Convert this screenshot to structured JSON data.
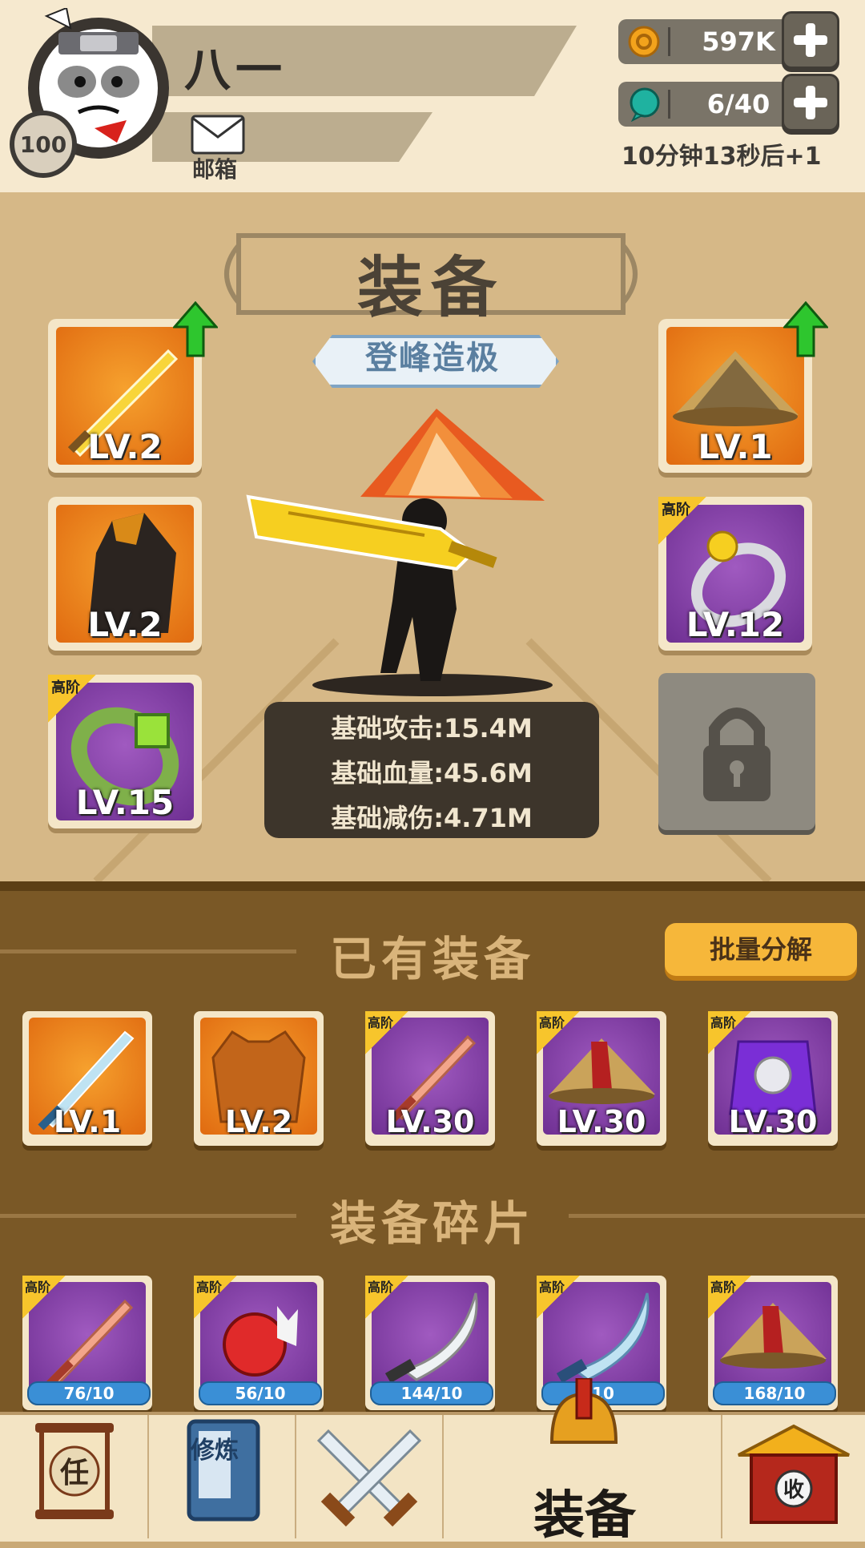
{
  "player": {
    "name": "八一",
    "level": "100",
    "mail_label": "邮箱"
  },
  "resources": {
    "gold": {
      "value": "597K",
      "icon": "coin-icon"
    },
    "stamina": {
      "value": "6/40",
      "icon": "gem-icon",
      "timer": "10分钟13秒后+1"
    }
  },
  "equipment": {
    "title": "装备",
    "rank": "登峰造极",
    "left_slots": [
      {
        "level": "LV.2",
        "icon": "golden-sword-icon",
        "rarity": "",
        "upgrade": true
      },
      {
        "level": "LV.2",
        "icon": "cloak-icon",
        "rarity": "",
        "upgrade": false
      },
      {
        "level": "LV.15",
        "icon": "jade-bracelet-icon",
        "rarity": "高阶",
        "upgrade": false
      }
    ],
    "right_slots": [
      {
        "level": "LV.1",
        "icon": "straw-hat-icon",
        "rarity": "",
        "upgrade": true
      },
      {
        "level": "LV.12",
        "icon": "ring-icon",
        "rarity": "高阶",
        "upgrade": false
      }
    ],
    "stats": [
      "基础攻击:15.4M",
      "基础血量:45.6M",
      "基础减伤:4.71M"
    ]
  },
  "owned": {
    "title": "已有装备",
    "batch_button": "批量分解",
    "items": [
      {
        "level": "LV.1",
        "icon": "blue-sword-icon",
        "rarity": ""
      },
      {
        "level": "LV.2",
        "icon": "vest-icon",
        "rarity": ""
      },
      {
        "level": "LV.30",
        "icon": "wooden-sword-icon",
        "rarity": "高阶"
      },
      {
        "level": "LV.30",
        "icon": "straw-hat-icon",
        "rarity": "高阶"
      },
      {
        "level": "LV.30",
        "icon": "purple-armor-icon",
        "rarity": "高阶"
      }
    ]
  },
  "fragments": {
    "title": "装备碎片",
    "items": [
      {
        "progress": "76/10",
        "icon": "wooden-sword-icon",
        "rarity": "高阶"
      },
      {
        "progress": "56/10",
        "icon": "red-gauntlet-icon",
        "rarity": "高阶"
      },
      {
        "progress": "144/10",
        "icon": "machete-icon",
        "rarity": "高阶"
      },
      {
        "progress": "10",
        "icon": "blue-blade-icon",
        "rarity": "高阶"
      },
      {
        "progress": "168/10",
        "icon": "straw-hat-icon",
        "rarity": "高阶"
      }
    ]
  },
  "nav": {
    "tabs": [
      {
        "label": "任",
        "icon": "scroll-icon"
      },
      {
        "label": "修炼",
        "icon": "book-icon"
      },
      {
        "label": "",
        "icon": "crossed-swords-icon"
      },
      {
        "label": "装备",
        "icon": "helmet-icon",
        "active": true
      },
      {
        "label": "收",
        "icon": "shop-icon"
      }
    ]
  },
  "colors": {
    "accent": "#f6b73a",
    "panel": "#d6b887",
    "inventory": "#7a5826",
    "rare": "#7a3aa0",
    "common": "#e8801c"
  }
}
